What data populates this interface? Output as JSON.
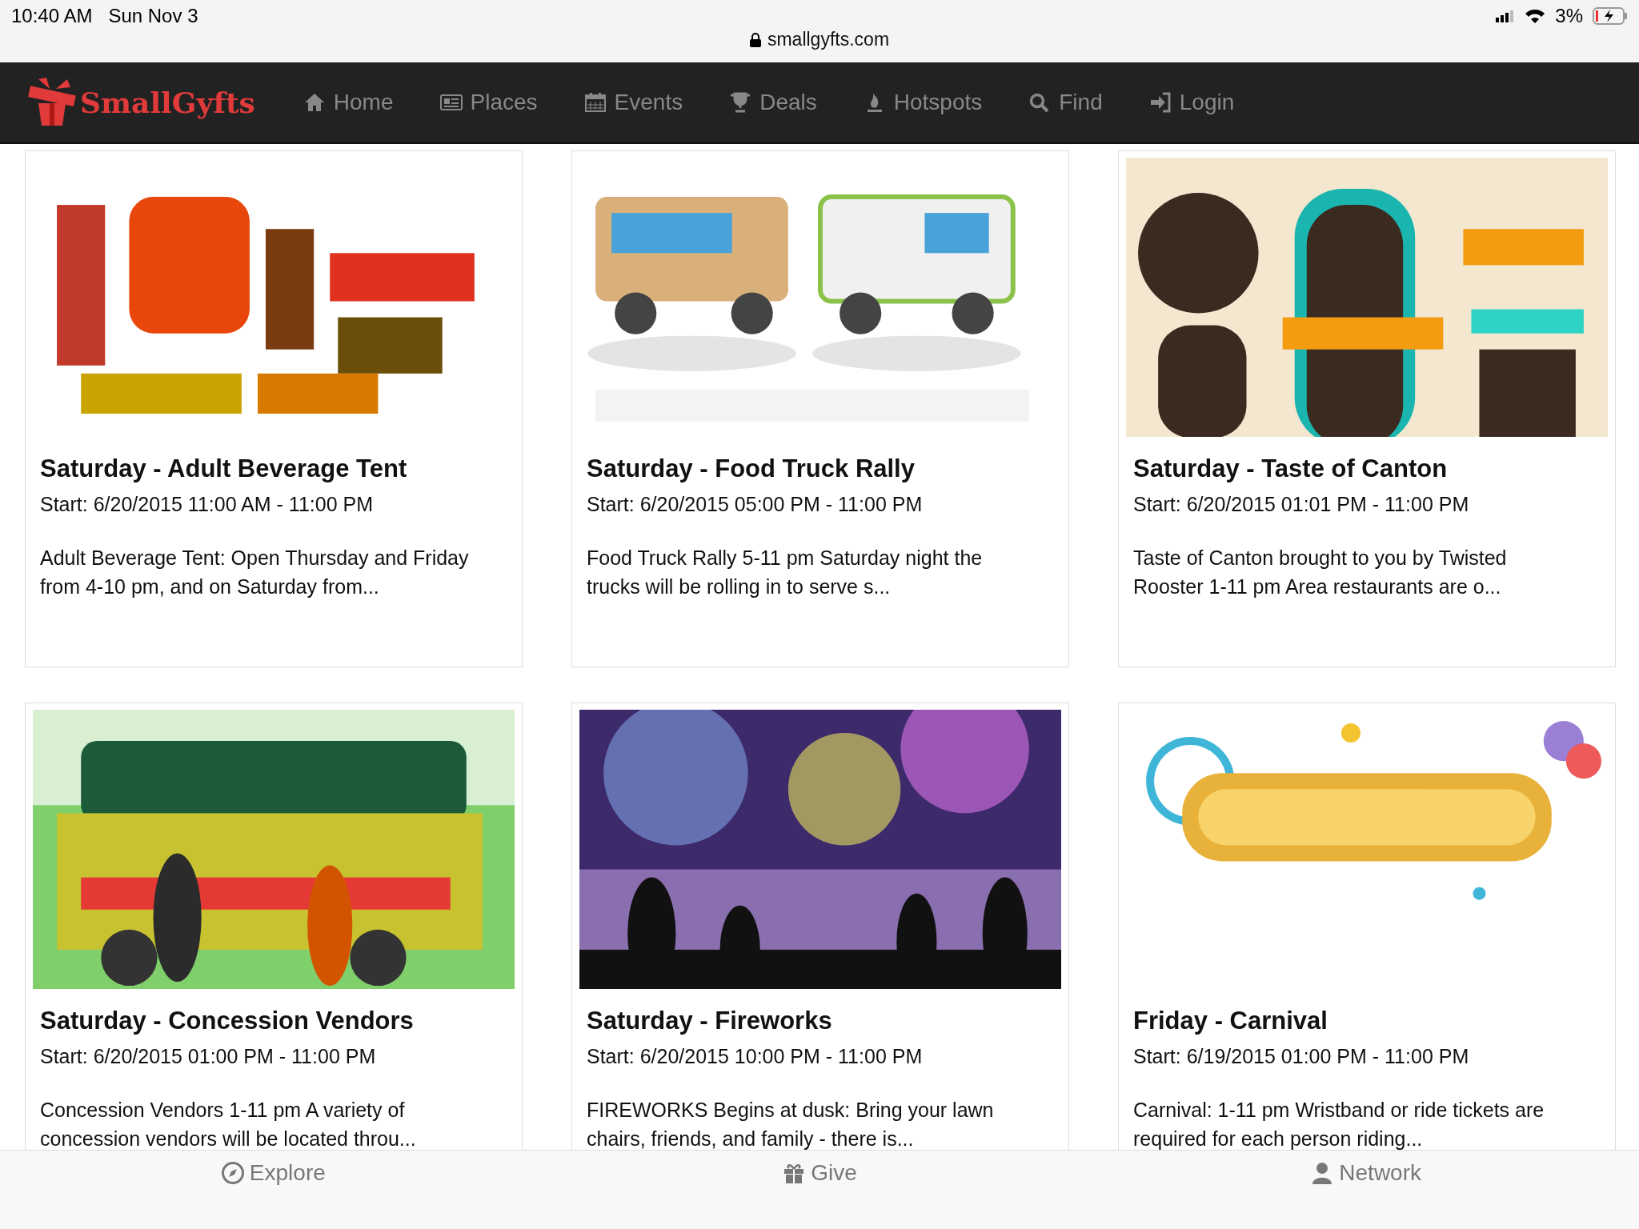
{
  "status_bar": {
    "time": "10:40 AM",
    "date": "Sun Nov 3",
    "url": "smallgyfts.com",
    "battery": "3%"
  },
  "brand": "SmallGyfts",
  "nav": [
    {
      "label": "Home"
    },
    {
      "label": "Places"
    },
    {
      "label": "Events"
    },
    {
      "label": "Deals"
    },
    {
      "label": "Hotspots"
    },
    {
      "label": "Find"
    },
    {
      "label": "Login"
    }
  ],
  "events": [
    {
      "title": "Saturday - Adult Beverage Tent",
      "start": "Start: 6/20/2015 11:00 AM - 11:00 PM",
      "description": "Adult Beverage Tent: Open Thursday and Friday from 4-10 pm, and on Saturday from..."
    },
    {
      "title": "Saturday - Food Truck Rally",
      "start": "Start: 6/20/2015 05:00 PM - 11:00 PM",
      "description": "Food Truck Rally 5-11 pm Saturday night the trucks will be rolling in to serve s..."
    },
    {
      "title": "Saturday - Taste of Canton",
      "start": "Start: 6/20/2015 01:01 PM - 11:00 PM",
      "description": "Taste of Canton brought to you by Twisted Rooster 1-11 pm Area restaurants are o..."
    },
    {
      "title": "Saturday - Concession Vendors",
      "start": "Start: 6/20/2015 01:00 PM - 11:00 PM",
      "description": "Concession Vendors 1-11 pm A variety of concession vendors will be located throu..."
    },
    {
      "title": "Saturday - Fireworks",
      "start": "Start: 6/20/2015 10:00 PM - 11:00 PM",
      "description": "FIREWORKS Begins at dusk: Bring your lawn chairs, friends, and family - there is..."
    },
    {
      "title": "Friday - Carnival",
      "start": "Start: 6/19/2015 01:00 PM - 11:00 PM",
      "description": "Carnival: 1-11 pm Wristband or ride tickets are required for each person riding..."
    }
  ],
  "tab_bar": [
    {
      "label": "Explore"
    },
    {
      "label": "Give"
    },
    {
      "label": "Network"
    }
  ]
}
